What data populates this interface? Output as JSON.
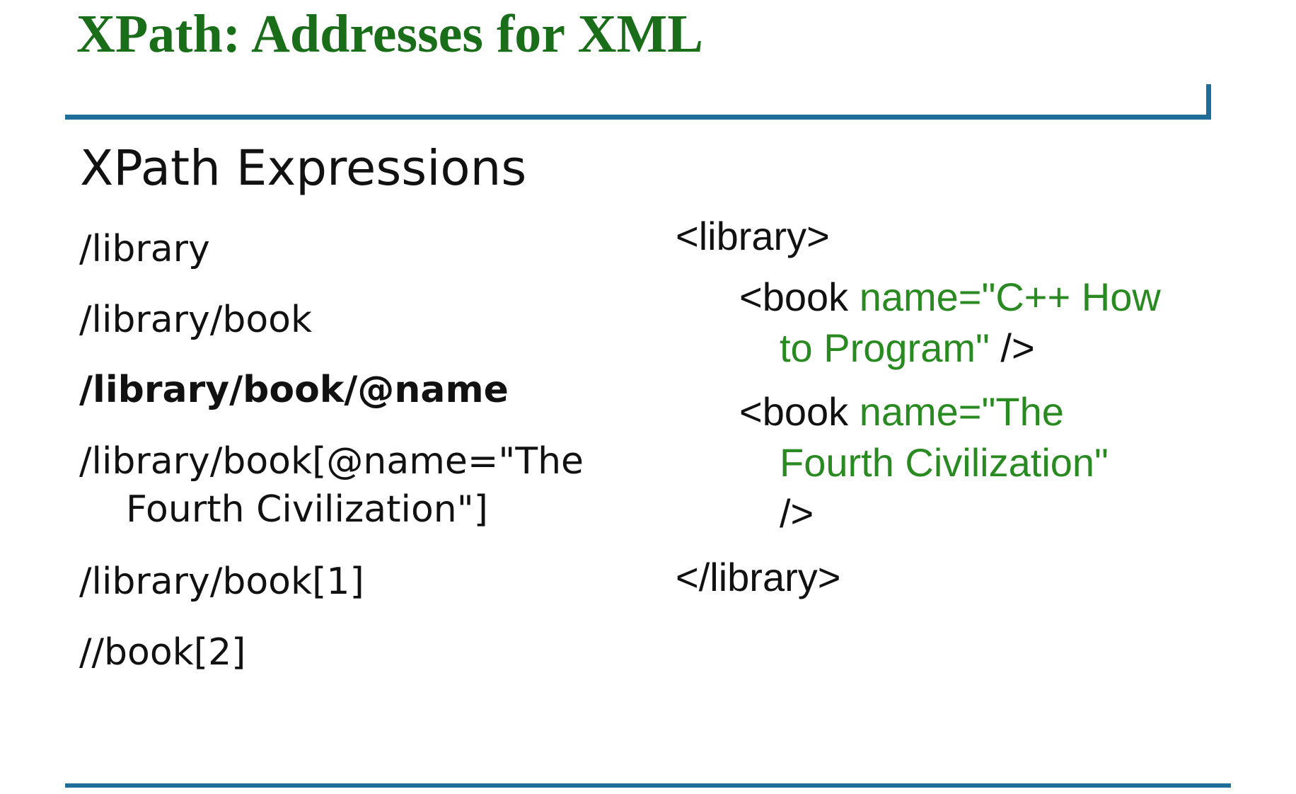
{
  "slide": {
    "title": "XPath: Addresses for XML",
    "subtitle": "XPath Expressions"
  },
  "expressions": [
    {
      "text": "/library",
      "bold": false
    },
    {
      "text": "/library/book",
      "bold": false
    },
    {
      "text": "/library/book/@name",
      "bold": true
    },
    {
      "text": "/library/book[@name=\"The",
      "continuation": "Fourth Civilization\"]",
      "bold": false
    },
    {
      "text": "/library/book[1]",
      "bold": false
    },
    {
      "text": "//book[2]",
      "bold": false
    }
  ],
  "xml": {
    "open_tag": "<library>",
    "books": [
      {
        "tag_start": "<book ",
        "attr_line1": "name=\"C++ How",
        "attr_line2": "to Program\"",
        "tag_end": " />"
      },
      {
        "tag_start": "<book ",
        "attr_line1": "name=\"The",
        "attr_line2": "Fourth Civilization\"",
        "tag_end": "/>"
      }
    ],
    "close_tag": "</library>"
  },
  "colors": {
    "title": "#1a6e1a",
    "rule": "#1f6e99",
    "attribute": "#2a8a22",
    "text": "#111111"
  }
}
